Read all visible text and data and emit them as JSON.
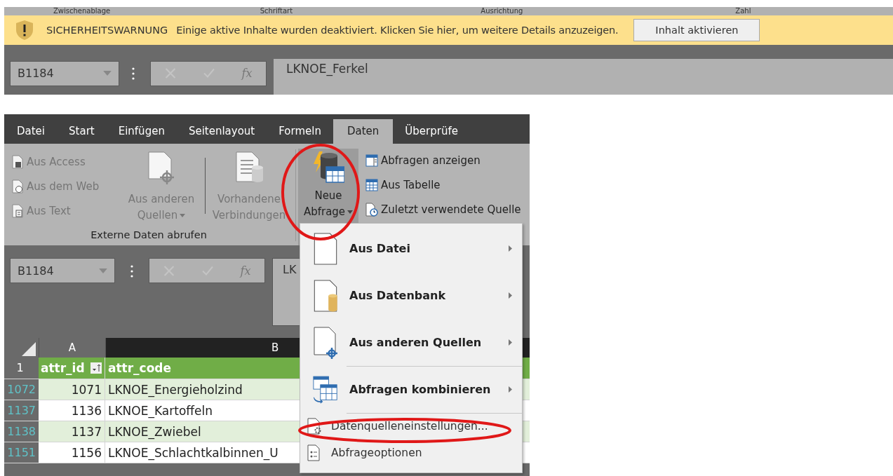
{
  "top_strip": {
    "group_labels": [
      "Zwischenablage",
      "Schriftart",
      "Ausrichtung",
      "Zahl"
    ],
    "security_bar": {
      "title": "SICHERHEITSWARNUNG",
      "message": "Einige aktive Inhalte wurden deaktiviert. Klicken Sie hier, um weitere Details anzuzeigen.",
      "button": "Inhalt aktivieren"
    },
    "name_box": "B1184",
    "fx": "fx",
    "formula": "LKNOE_Ferkel"
  },
  "ribbon": {
    "tabs": [
      {
        "label": "Datei",
        "selected": false
      },
      {
        "label": "Start",
        "selected": false
      },
      {
        "label": "Einfügen",
        "selected": false
      },
      {
        "label": "Seitenlayout",
        "selected": false
      },
      {
        "label": "Formeln",
        "selected": false
      },
      {
        "label": "Daten",
        "selected": true
      },
      {
        "label": "Überprüfe",
        "selected": false
      }
    ],
    "external_group": {
      "label": "Externe Daten abrufen",
      "small_buttons": [
        {
          "kind": "access",
          "label": "Aus Access",
          "disabled": true
        },
        {
          "kind": "web",
          "label": "Aus dem Web",
          "disabled": true
        },
        {
          "kind": "text",
          "label": "Aus Text",
          "disabled": true
        }
      ],
      "large_buttons": [
        {
          "kind": "sources",
          "lines": [
            "Aus anderen",
            "Quellen"
          ],
          "dropdown": true,
          "disabled": true
        },
        {
          "kind": "connections",
          "lines": [
            "Vorhandene",
            "Verbindungen"
          ],
          "dropdown": false,
          "disabled": true
        }
      ]
    },
    "query_button": {
      "lines": [
        "Neue",
        "Abfrage"
      ],
      "dropdown": true,
      "pressed": true
    },
    "query_small_buttons": [
      {
        "kind": "show",
        "label": "Abfragen anzeigen",
        "disabled": false
      },
      {
        "kind": "table",
        "label": "Aus Tabelle",
        "disabled": false
      },
      {
        "kind": "recent",
        "label": "Zuletzt verwendete Quelle",
        "disabled": false
      }
    ]
  },
  "sheet": {
    "name_box": "B1184",
    "fx": "fx",
    "formula": "LK",
    "columns": [
      {
        "label": "A",
        "selected": false
      },
      {
        "label": "B",
        "selected": true
      }
    ],
    "header_row": {
      "number": "1",
      "cells": [
        "attr_id",
        "attr_code"
      ]
    },
    "rows": [
      {
        "number": "1072",
        "cells": [
          "1071",
          "LKNOE_Energieholzind"
        ]
      },
      {
        "number": "1137",
        "cells": [
          "1136",
          "LKNOE_Kartoffeln"
        ]
      },
      {
        "number": "1138",
        "cells": [
          "1137",
          "LKNOE_Zwiebel"
        ]
      },
      {
        "number": "1151",
        "cells": [
          "1156",
          "LKNOE_Schlachtkalbinnen_U"
        ]
      }
    ]
  },
  "menu": {
    "items": [
      {
        "kind": "file",
        "label": "Aus Datei",
        "submenu": true,
        "separator_before": false
      },
      {
        "kind": "database",
        "label": "Aus Datenbank",
        "submenu": true,
        "separator_before": false
      },
      {
        "kind": "sources",
        "label": "Aus anderen Quellen",
        "submenu": true,
        "separator_before": false
      },
      {
        "kind": "combine",
        "label": "Abfragen kombinieren",
        "submenu": true,
        "separator_before": true
      },
      {
        "kind": "settings",
        "label": "Datenquelleneinstellungen...",
        "submenu": false,
        "separator_before": true
      },
      {
        "kind": "options",
        "label": "Abfrageoptionen",
        "submenu": false,
        "separator_before": false
      }
    ]
  }
}
